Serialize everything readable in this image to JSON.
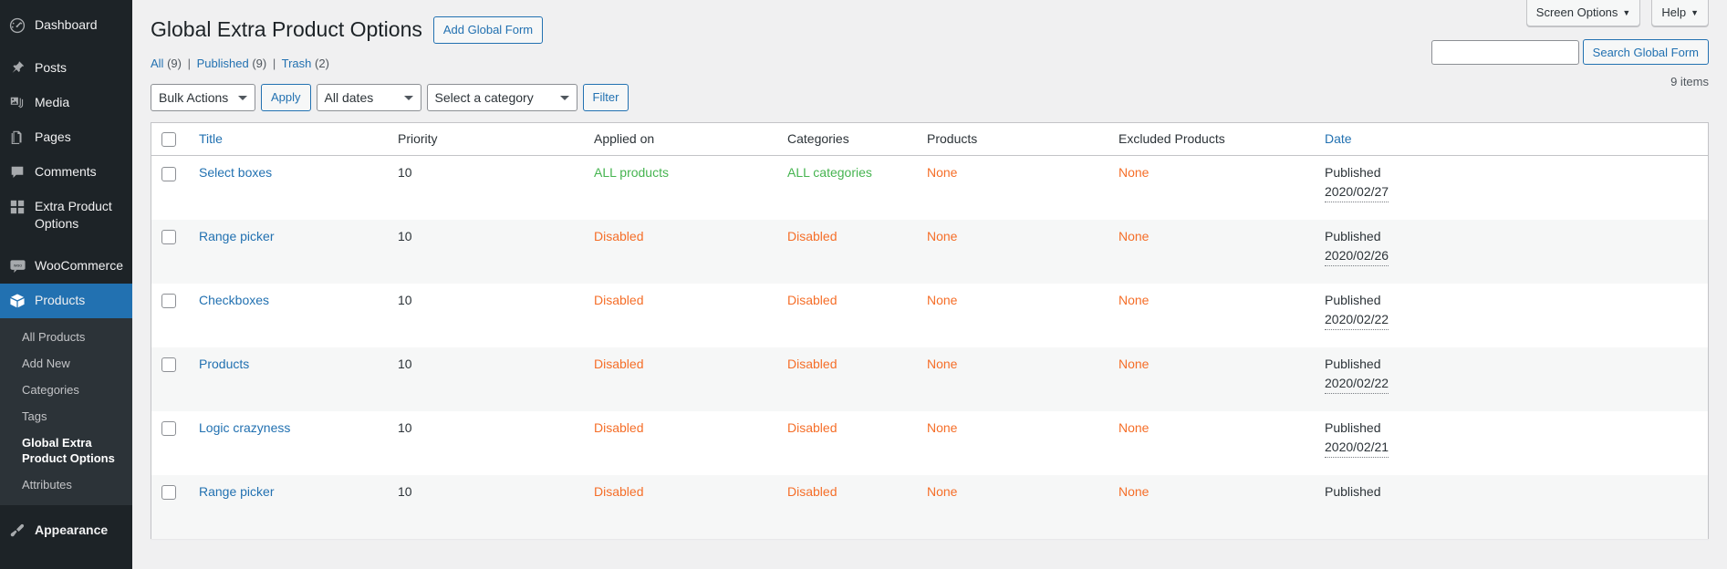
{
  "colors": {
    "wp_blue": "#2271b1",
    "sidebar_bg": "#1d2327",
    "submenu_bg": "#2c3338",
    "green": "#46b450",
    "orange": "#f56e28"
  },
  "sidebar": {
    "items": [
      {
        "label": "Dashboard",
        "icon": "dashboard-icon",
        "current": false
      },
      {
        "label": "Posts",
        "icon": "pin-icon",
        "current": false
      },
      {
        "label": "Media",
        "icon": "media-icon",
        "current": false
      },
      {
        "label": "Pages",
        "icon": "pages-icon",
        "current": false
      },
      {
        "label": "Comments",
        "icon": "comments-icon",
        "current": false
      },
      {
        "label": "Extra Product Options",
        "icon": "grid-icon",
        "current": false
      },
      {
        "label": "WooCommerce",
        "icon": "woocommerce-icon",
        "current": false
      },
      {
        "label": "Products",
        "icon": "products-box-icon",
        "current": true
      },
      {
        "label": "Appearance",
        "icon": "appearance-brush-icon",
        "current": false
      }
    ],
    "submenu": [
      {
        "label": "All Products",
        "current": false
      },
      {
        "label": "Add New",
        "current": false
      },
      {
        "label": "Categories",
        "current": false
      },
      {
        "label": "Tags",
        "current": false
      },
      {
        "label": "Global Extra Product Options",
        "current": true
      },
      {
        "label": "Attributes",
        "current": false
      }
    ]
  },
  "screen_meta": {
    "screen_options": "Screen Options",
    "help": "Help",
    "caret": "▼"
  },
  "header": {
    "title": "Global Extra Product Options",
    "add_button": "Add Global Form"
  },
  "status_links": [
    {
      "label": "All",
      "count": "(9)"
    },
    {
      "label": "Published",
      "count": "(9)"
    },
    {
      "label": "Trash",
      "count": "(2)"
    }
  ],
  "search": {
    "value": "",
    "placeholder": "",
    "button": "Search Global Form"
  },
  "tablenav": {
    "bulk_actions": "Bulk Actions",
    "apply": "Apply",
    "all_dates": "All dates",
    "select_category": "Select a category",
    "filter": "Filter",
    "items_count": "9 items"
  },
  "table": {
    "columns": [
      {
        "key": "cb",
        "label": "",
        "sortable": false
      },
      {
        "key": "title",
        "label": "Title",
        "sortable": true
      },
      {
        "key": "priority",
        "label": "Priority",
        "sortable": false
      },
      {
        "key": "applied_on",
        "label": "Applied on",
        "sortable": false
      },
      {
        "key": "categories",
        "label": "Categories",
        "sortable": false
      },
      {
        "key": "products",
        "label": "Products",
        "sortable": false
      },
      {
        "key": "excluded_products",
        "label": "Excluded Products",
        "sortable": false
      },
      {
        "key": "date",
        "label": "Date",
        "sortable": true
      }
    ],
    "rows": [
      {
        "title": "Select boxes",
        "priority": "10",
        "applied_on": "ALL products",
        "applied_on_state": "green",
        "categories": "ALL categories",
        "categories_state": "green",
        "products": "None",
        "products_state": "red",
        "excluded_products": "None",
        "excluded_products_state": "red",
        "date_status": "Published",
        "date_value": "2020/02/27"
      },
      {
        "title": "Range picker",
        "priority": "10",
        "applied_on": "Disabled",
        "applied_on_state": "red",
        "categories": "Disabled",
        "categories_state": "red",
        "products": "None",
        "products_state": "red",
        "excluded_products": "None",
        "excluded_products_state": "red",
        "date_status": "Published",
        "date_value": "2020/02/26"
      },
      {
        "title": "Checkboxes",
        "priority": "10",
        "applied_on": "Disabled",
        "applied_on_state": "red",
        "categories": "Disabled",
        "categories_state": "red",
        "products": "None",
        "products_state": "red",
        "excluded_products": "None",
        "excluded_products_state": "red",
        "date_status": "Published",
        "date_value": "2020/02/22"
      },
      {
        "title": "Products",
        "priority": "10",
        "applied_on": "Disabled",
        "applied_on_state": "red",
        "categories": "Disabled",
        "categories_state": "red",
        "products": "None",
        "products_state": "red",
        "excluded_products": "None",
        "excluded_products_state": "red",
        "date_status": "Published",
        "date_value": "2020/02/22"
      },
      {
        "title": "Logic crazyness",
        "priority": "10",
        "applied_on": "Disabled",
        "applied_on_state": "red",
        "categories": "Disabled",
        "categories_state": "red",
        "products": "None",
        "products_state": "red",
        "excluded_products": "None",
        "excluded_products_state": "red",
        "date_status": "Published",
        "date_value": "2020/02/21"
      },
      {
        "title": "Range picker",
        "priority": "10",
        "applied_on": "Disabled",
        "applied_on_state": "red",
        "categories": "Disabled",
        "categories_state": "red",
        "products": "None",
        "products_state": "red",
        "excluded_products": "None",
        "excluded_products_state": "red",
        "date_status": "Published",
        "date_value": ""
      }
    ]
  }
}
